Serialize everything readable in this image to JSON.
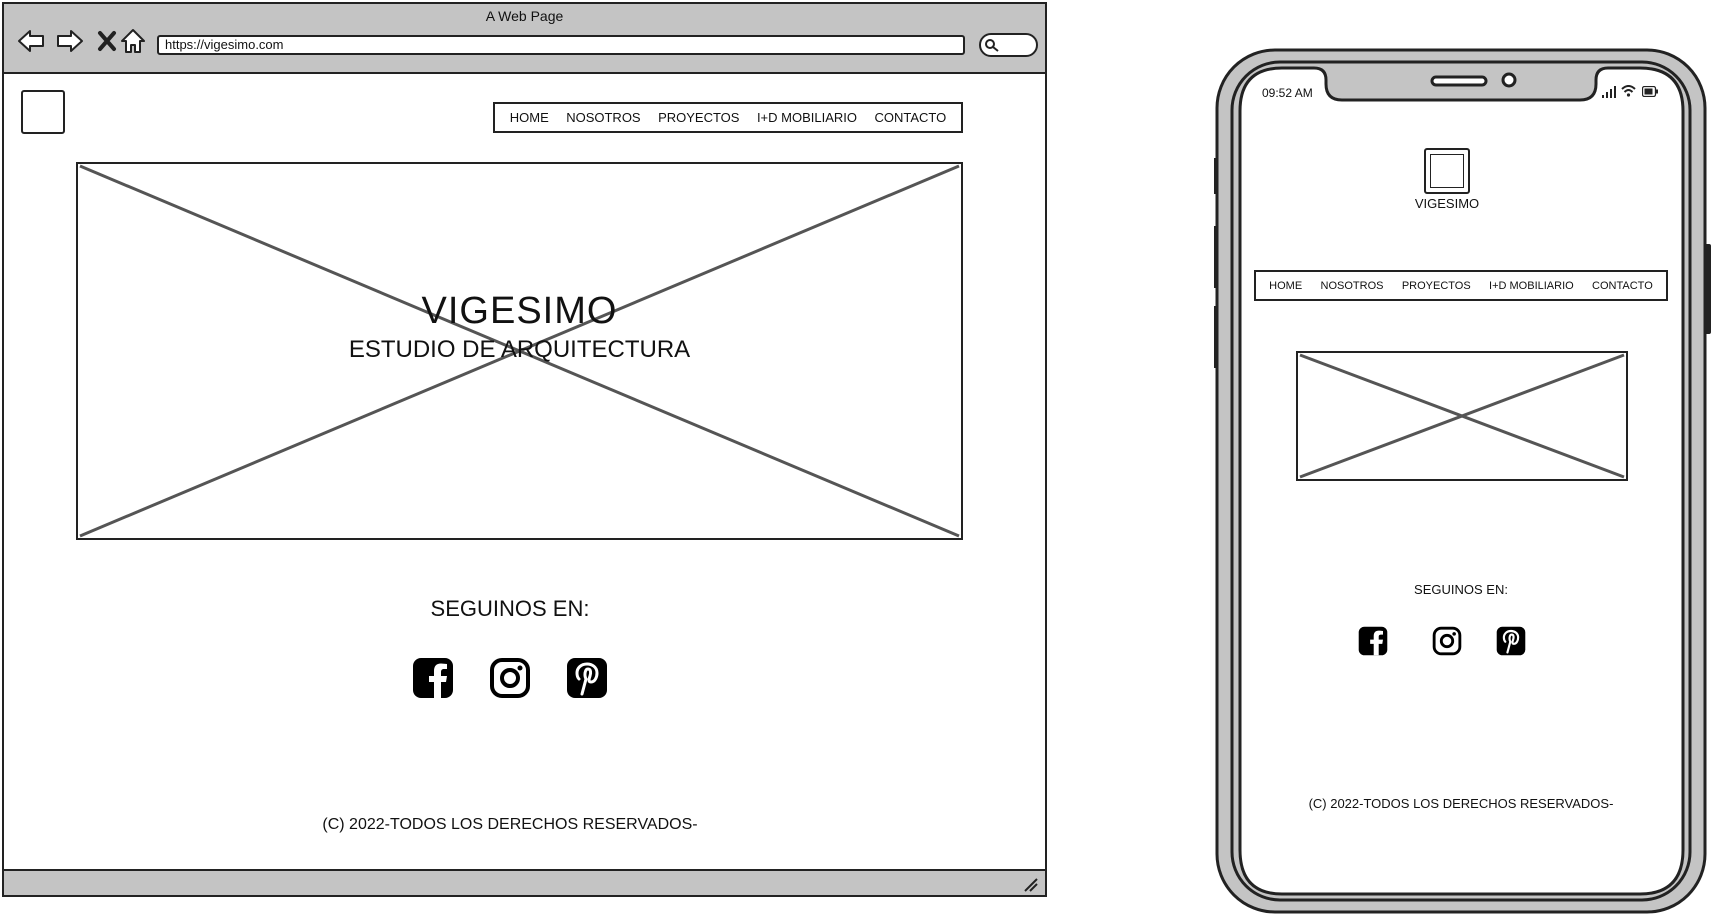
{
  "browser": {
    "title": "A Web Page",
    "url": "https://vigesimo.com"
  },
  "desktop": {
    "nav": [
      "HOME",
      "NOSOTROS",
      "PROYECTOS",
      "I+D MOBILIARIO",
      "CONTACTO"
    ],
    "hero_title": "VIGESIMO",
    "hero_subtitle": "ESTUDIO DE ARQUITECTURA",
    "follow_title": "SEGUINOS EN:",
    "social_icons": [
      "facebook-icon",
      "instagram-icon",
      "pinterest-icon"
    ],
    "footer": "(C) 2022-TODOS LOS DERECHOS RESERVADOS-"
  },
  "mobile": {
    "time": "09:52 AM",
    "brand": "VIGESIMO",
    "nav": [
      "HOME",
      "NOSOTROS",
      "PROYECTOS",
      "I+D MOBILIARIO",
      "CONTACTO"
    ],
    "follow_title": "SEGUINOS EN:",
    "social_icons": [
      "facebook-icon",
      "instagram-icon",
      "pinterest-icon"
    ],
    "footer": "(C) 2022-TODOS LOS DERECHOS RESERVADOS-",
    "status_icons": [
      "signal-icon",
      "wifi-icon",
      "battery-icon"
    ]
  },
  "colors": {
    "chrome": "#c4c4c4",
    "stroke": "#222222",
    "placeholder_x": "#555555"
  }
}
